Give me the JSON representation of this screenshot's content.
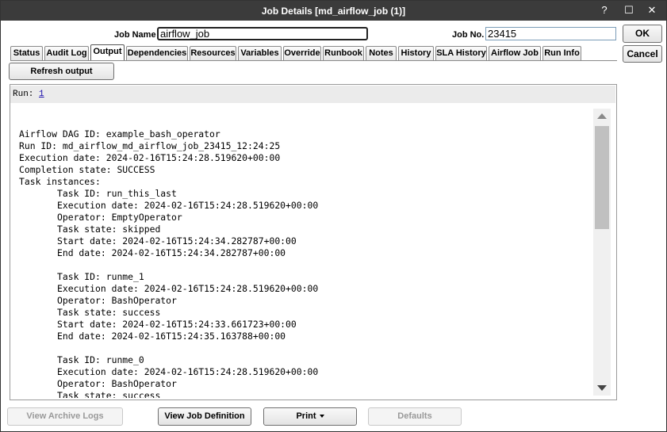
{
  "window": {
    "title": "Job Details [md_airflow_job (1)]",
    "help_icon": "?",
    "maximize_icon": "☐",
    "close_icon": "✕"
  },
  "header": {
    "job_name_label": "Job Name",
    "job_name_value": "airflow_job",
    "job_no_label": "Job No.",
    "job_no_value": "23415"
  },
  "actions": {
    "ok": "OK",
    "cancel": "Cancel",
    "refresh_output": "Refresh output"
  },
  "tabs": [
    {
      "label": "Status"
    },
    {
      "label": "Audit Log"
    },
    {
      "label": "Output",
      "active": true
    },
    {
      "label": "Dependencies"
    },
    {
      "label": "Resources"
    },
    {
      "label": "Variables"
    },
    {
      "label": "Override"
    },
    {
      "label": "Runbook"
    },
    {
      "label": "Notes"
    },
    {
      "label": "History"
    },
    {
      "label": "SLA History"
    },
    {
      "label": "Airflow Job"
    },
    {
      "label": "Run Info"
    }
  ],
  "run": {
    "label": "Run:",
    "value": "1"
  },
  "output_lines": [
    "Airflow DAG ID: example_bash_operator",
    "Run ID: md_airflow_md_airflow_job_23415_12:24:25",
    "Execution date: 2024-02-16T15:24:28.519620+00:00",
    "Completion state: SUCCESS",
    "Task instances:",
    "       Task ID: run_this_last",
    "       Execution date: 2024-02-16T15:24:28.519620+00:00",
    "       Operator: EmptyOperator",
    "       Task state: skipped",
    "       Start date: 2024-02-16T15:24:34.282787+00:00",
    "       End date: 2024-02-16T15:24:34.282787+00:00",
    "",
    "       Task ID: runme_1",
    "       Execution date: 2024-02-16T15:24:28.519620+00:00",
    "       Operator: BashOperator",
    "       Task state: success",
    "       Start date: 2024-02-16T15:24:33.661723+00:00",
    "       End date: 2024-02-16T15:24:35.163788+00:00",
    "",
    "       Task ID: runme_0",
    "       Execution date: 2024-02-16T15:24:28.519620+00:00",
    "       Operator: BashOperator",
    "       Task state: success"
  ],
  "footer": {
    "view_archive_logs": "View Archive Logs",
    "view_job_definition": "View Job Definition",
    "print": "Print",
    "defaults": "Defaults"
  }
}
